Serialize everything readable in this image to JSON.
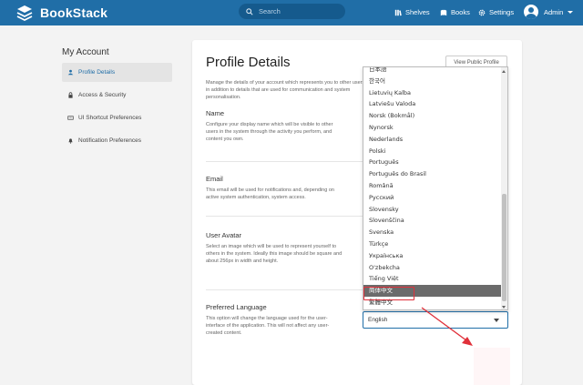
{
  "app": {
    "name": "BookStack"
  },
  "header": {
    "search_placeholder": "Search",
    "nav": [
      {
        "label": "Shelves",
        "icon": "shelves-icon"
      },
      {
        "label": "Books",
        "icon": "books-icon"
      },
      {
        "label": "Settings",
        "icon": "gear-icon"
      }
    ],
    "user": {
      "name": "Admin"
    }
  },
  "sidebar": {
    "title": "My Account",
    "items": [
      {
        "label": "Profile Details",
        "icon": "user-icon",
        "active": true
      },
      {
        "label": "Access & Security",
        "icon": "lock-icon",
        "active": false
      },
      {
        "label": "UI Shortcut Preferences",
        "icon": "keyboard-icon",
        "active": false
      },
      {
        "label": "Notification Preferences",
        "icon": "bell-icon",
        "active": false
      }
    ]
  },
  "main": {
    "title": "Profile Details",
    "view_public_label": "View Public Profile",
    "intro": "Manage the details of your account which represents you to other users, in addition to details that are used for communication and system personalisation.",
    "sections": {
      "name": {
        "title": "Name",
        "desc": "Configure your display name which will be visible to other users in the system through the activity you perform, and content you own."
      },
      "email": {
        "title": "Email",
        "desc": "This email will be used for notifications and, depending on active system authentication, system access."
      },
      "avatar": {
        "title": "User Avatar",
        "desc": "Select an image which will be used to represent yourself to others in the system. Ideally this image should be square and about 256px in width and height."
      },
      "language": {
        "title": "Preferred Language",
        "desc": "This option will change the language used for the user-interface of the application. This will not affect any user-created content."
      }
    },
    "language_select": {
      "value": "English",
      "options": [
        "日本語",
        "한국어",
        "Lietuvių Kalba",
        "Latviešu Valoda",
        "Norsk (Bokmål)",
        "Nynorsk",
        "Nederlands",
        "Polski",
        "Português",
        "Português do Brasil",
        "Română",
        "Русский",
        "Slovensky",
        "Slovenščina",
        "Svenska",
        "Türkçe",
        "Українська",
        "O'zbekcha",
        "Tiếng Việt",
        "简体中文",
        "繁體中文"
      ],
      "highlighted": "简体中文"
    }
  },
  "colors": {
    "header": "#206ea7",
    "annotation": "#e0303a"
  }
}
